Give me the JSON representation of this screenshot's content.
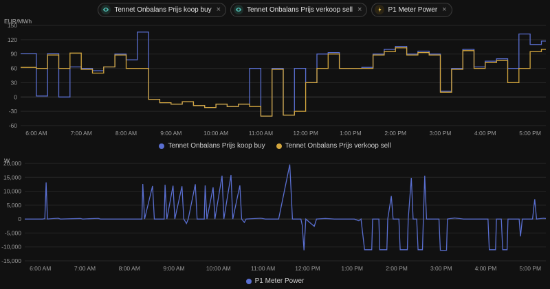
{
  "page": {
    "background": "#111111"
  },
  "chips": [
    {
      "label": "Tennet Onbalans Prijs koop buy",
      "icon": "eye",
      "close": "×"
    },
    {
      "label": "Tennet Onbalans Prijs verkoop sell",
      "icon": "eye",
      "close": "×"
    },
    {
      "label": "P1 Meter Power",
      "icon": "lightning-bolt",
      "close": "×"
    }
  ],
  "colors": {
    "buy": "#5a6fd1",
    "sell": "#d4a73e",
    "power": "#5a6fd1",
    "grid": "#272727",
    "tick_text": "#9a9a9a"
  },
  "chart_data": [
    {
      "type": "line",
      "step": true,
      "title": "",
      "ylabel": "EUR/MWh",
      "xlabel": "",
      "ylim": [
        -60,
        150
      ],
      "x_range": [
        5.65,
        17.35
      ],
      "grid": true,
      "legend_position": "bottom",
      "yticks": [
        {
          "v": 150,
          "label": "150"
        },
        {
          "v": 120,
          "label": "120"
        },
        {
          "v": 90,
          "label": "90"
        },
        {
          "v": 60,
          "label": "60"
        },
        {
          "v": 30,
          "label": "30"
        },
        {
          "v": 0,
          "label": "0"
        },
        {
          "v": -30,
          "label": "-30"
        },
        {
          "v": -60,
          "label": "-60"
        }
      ],
      "xticks": [
        {
          "h": 6,
          "label": "6:00 AM"
        },
        {
          "h": 7,
          "label": "7:00 AM"
        },
        {
          "h": 8,
          "label": "8:00 AM"
        },
        {
          "h": 9,
          "label": "9:00 AM"
        },
        {
          "h": 10,
          "label": "10:00 AM"
        },
        {
          "h": 11,
          "label": "11:00 AM"
        },
        {
          "h": 12,
          "label": "12:00 PM"
        },
        {
          "h": 13,
          "label": "1:00 PM"
        },
        {
          "h": 14,
          "label": "2:00 PM"
        },
        {
          "h": 15,
          "label": "3:00 PM"
        },
        {
          "h": 16,
          "label": "4:00 PM"
        },
        {
          "h": 17,
          "label": "5:00 PM"
        }
      ],
      "series": [
        {
          "name": "Tennet Onbalans Prijs koop buy",
          "color": "#5a6fd1",
          "x": [
            5.65,
            5.75,
            6.0,
            6.25,
            6.5,
            6.75,
            7.0,
            7.25,
            7.5,
            7.75,
            8.0,
            8.25,
            8.5,
            8.75,
            9.0,
            9.25,
            9.5,
            9.75,
            10.0,
            10.25,
            10.5,
            10.75,
            11.0,
            11.25,
            11.5,
            11.75,
            12.0,
            12.25,
            12.5,
            12.75,
            13.0,
            13.25,
            13.5,
            13.75,
            14.0,
            14.25,
            14.5,
            14.75,
            15.0,
            15.25,
            15.5,
            15.75,
            16.0,
            16.25,
            16.5,
            16.75,
            17.0,
            17.25
          ],
          "values": [
            91,
            91,
            2,
            91,
            0,
            63,
            60,
            55,
            63,
            90,
            78,
            136,
            -5,
            -12,
            -15,
            -10,
            -18,
            -22,
            -15,
            -20,
            -15,
            60,
            -40,
            60,
            -38,
            60,
            30,
            90,
            93,
            60,
            60,
            62,
            90,
            100,
            106,
            90,
            96,
            90,
            12,
            60,
            100,
            63,
            75,
            80,
            60,
            132,
            110,
            117
          ]
        },
        {
          "name": "Tennet Onbalans Prijs verkoop sell",
          "color": "#d4a73e",
          "x": [
            5.65,
            5.75,
            6.0,
            6.25,
            6.5,
            6.75,
            7.0,
            7.25,
            7.5,
            7.75,
            8.0,
            8.25,
            8.5,
            8.75,
            9.0,
            9.25,
            9.5,
            9.75,
            10.0,
            10.25,
            10.5,
            10.75,
            11.0,
            11.25,
            11.5,
            11.75,
            12.0,
            12.25,
            12.5,
            12.75,
            13.0,
            13.25,
            13.5,
            13.75,
            14.0,
            14.25,
            14.5,
            14.75,
            15.0,
            15.25,
            15.5,
            15.75,
            16.0,
            16.25,
            16.5,
            16.75,
            17.0,
            17.25
          ],
          "values": [
            62,
            62,
            60,
            88,
            60,
            92,
            58,
            50,
            63,
            88,
            60,
            60,
            -5,
            -12,
            -15,
            -10,
            -18,
            -22,
            -15,
            -20,
            -15,
            -20,
            -40,
            58,
            -38,
            -30,
            30,
            60,
            90,
            60,
            60,
            60,
            88,
            95,
            103,
            88,
            93,
            88,
            10,
            58,
            97,
            60,
            72,
            76,
            30,
            60,
            95,
            100
          ]
        }
      ],
      "legend": [
        "Tennet Onbalans Prijs koop buy",
        "Tennet Onbalans Prijs verkoop sell"
      ]
    },
    {
      "type": "line",
      "step": false,
      "title": "",
      "ylabel": "W",
      "xlabel": "",
      "ylim": [
        -15000,
        20000
      ],
      "x_range": [
        5.65,
        17.35
      ],
      "grid": true,
      "legend_position": "bottom",
      "yticks": [
        {
          "v": 20000,
          "label": "20,000"
        },
        {
          "v": 15000,
          "label": "15,000"
        },
        {
          "v": 10000,
          "label": "10,000"
        },
        {
          "v": 5000,
          "label": "5,000"
        },
        {
          "v": 0,
          "label": "0"
        },
        {
          "v": -5000,
          "label": "-5,000"
        },
        {
          "v": -10000,
          "label": "-10,000"
        },
        {
          "v": -15000,
          "label": "-15,000"
        }
      ],
      "xticks": [
        {
          "h": 6,
          "label": "6:00 AM"
        },
        {
          "h": 7,
          "label": "7:00 AM"
        },
        {
          "h": 8,
          "label": "8:00 AM"
        },
        {
          "h": 9,
          "label": "9:00 AM"
        },
        {
          "h": 10,
          "label": "10:00 AM"
        },
        {
          "h": 11,
          "label": "11:00 AM"
        },
        {
          "h": 12,
          "label": "12:00 PM"
        },
        {
          "h": 13,
          "label": "1:00 PM"
        },
        {
          "h": 14,
          "label": "2:00 PM"
        },
        {
          "h": 15,
          "label": "3:00 PM"
        },
        {
          "h": 16,
          "label": "4:00 PM"
        },
        {
          "h": 17,
          "label": "5:00 PM"
        }
      ],
      "series": [
        {
          "name": "P1 Meter Power",
          "color": "#5a6fd1",
          "points": [
            [
              5.65,
              0
            ],
            [
              6.05,
              0
            ],
            [
              6.1,
              100
            ],
            [
              6.13,
              13200
            ],
            [
              6.16,
              0
            ],
            [
              6.4,
              300
            ],
            [
              6.45,
              0
            ],
            [
              6.9,
              200
            ],
            [
              6.95,
              0
            ],
            [
              7.3,
              250
            ],
            [
              7.35,
              0
            ],
            [
              7.8,
              0
            ],
            [
              8.28,
              0
            ],
            [
              8.3,
              12600
            ],
            [
              8.34,
              0
            ],
            [
              8.52,
              11900
            ],
            [
              8.56,
              0
            ],
            [
              8.78,
              0
            ],
            [
              8.8,
              12300
            ],
            [
              8.84,
              0
            ],
            [
              8.98,
              12000
            ],
            [
              9.02,
              0
            ],
            [
              9.18,
              11800
            ],
            [
              9.22,
              0
            ],
            [
              9.28,
              -1600
            ],
            [
              9.32,
              0
            ],
            [
              9.48,
              12500
            ],
            [
              9.52,
              0
            ],
            [
              9.68,
              0
            ],
            [
              9.7,
              12100
            ],
            [
              9.74,
              0
            ],
            [
              9.88,
              11400
            ],
            [
              9.92,
              0
            ],
            [
              10.08,
              15600
            ],
            [
              10.12,
              0
            ],
            [
              10.28,
              15800
            ],
            [
              10.32,
              0
            ],
            [
              10.48,
              12100
            ],
            [
              10.52,
              0
            ],
            [
              10.58,
              -1200
            ],
            [
              10.62,
              0
            ],
            [
              10.95,
              300
            ],
            [
              11.05,
              0
            ],
            [
              11.35,
              0
            ],
            [
              11.6,
              19600
            ],
            [
              11.66,
              0
            ],
            [
              11.85,
              0
            ],
            [
              11.88,
              -2200
            ],
            [
              11.92,
              -11200
            ],
            [
              11.96,
              0
            ],
            [
              12.15,
              -2600
            ],
            [
              12.2,
              0
            ],
            [
              12.4,
              200
            ],
            [
              12.6,
              0
            ],
            [
              13.05,
              0
            ],
            [
              13.15,
              -600
            ],
            [
              13.2,
              0
            ],
            [
              13.28,
              -11000
            ],
            [
              13.44,
              -11000
            ],
            [
              13.46,
              0
            ],
            [
              13.6,
              0
            ],
            [
              13.62,
              -11000
            ],
            [
              13.78,
              -11000
            ],
            [
              13.8,
              0
            ],
            [
              13.88,
              8300
            ],
            [
              13.92,
              0
            ],
            [
              14.05,
              0
            ],
            [
              14.08,
              -11000
            ],
            [
              14.24,
              -11000
            ],
            [
              14.26,
              0
            ],
            [
              14.33,
              14800
            ],
            [
              14.37,
              0
            ],
            [
              14.45,
              0
            ],
            [
              14.48,
              -11000
            ],
            [
              14.58,
              -11000
            ],
            [
              14.6,
              0
            ],
            [
              14.63,
              15600
            ],
            [
              14.67,
              0
            ],
            [
              14.95,
              0
            ],
            [
              14.98,
              -11200
            ],
            [
              15.12,
              -11200
            ],
            [
              15.14,
              0
            ],
            [
              15.3,
              400
            ],
            [
              15.5,
              0
            ],
            [
              16.05,
              0
            ],
            [
              16.08,
              -11000
            ],
            [
              16.22,
              -11000
            ],
            [
              16.24,
              0
            ],
            [
              16.35,
              0
            ],
            [
              16.38,
              -11000
            ],
            [
              16.48,
              -11000
            ],
            [
              16.5,
              0
            ],
            [
              16.75,
              0
            ],
            [
              16.78,
              -6200
            ],
            [
              16.82,
              0
            ],
            [
              17.05,
              0
            ],
            [
              17.1,
              7100
            ],
            [
              17.14,
              0
            ],
            [
              17.3,
              300
            ],
            [
              17.35,
              200
            ]
          ]
        }
      ],
      "legend": [
        "P1 Meter Power"
      ]
    }
  ]
}
